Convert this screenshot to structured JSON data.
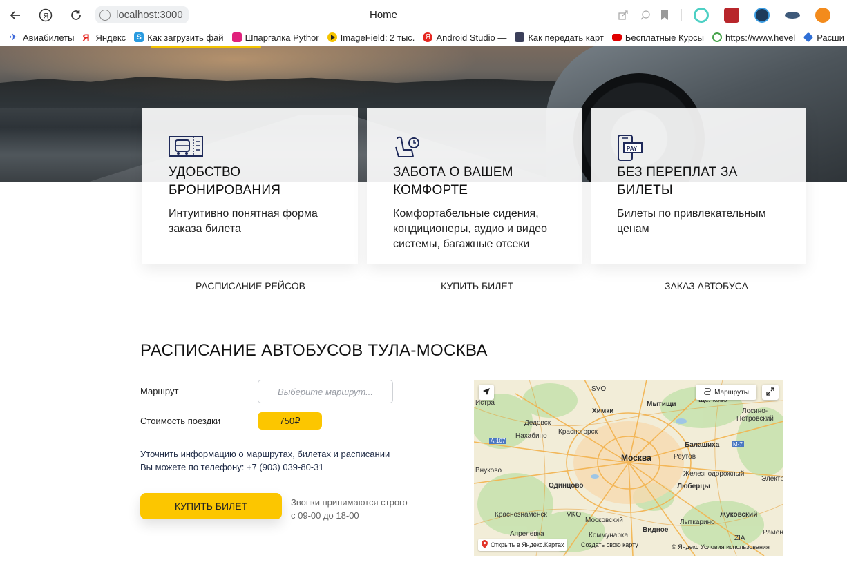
{
  "browser": {
    "address": "localhost:3000",
    "page_title": "Home",
    "bookmarks": [
      {
        "label": "Авиабилеты",
        "icon": "plane-icon",
        "color": "#3a66d9"
      },
      {
        "label": "Яндекс",
        "icon": "yandex-icon",
        "color": "#e52620"
      },
      {
        "label": "Как загрузить фай",
        "icon": "s-icon",
        "color": "#2a9be0"
      },
      {
        "label": "Шпаргалка Pythor",
        "icon": "folder-icon",
        "color": "#e0217c"
      },
      {
        "label": "ImageField: 2 тыс.",
        "icon": "play-icon",
        "color": "#f5c400"
      },
      {
        "label": "Android Studio —",
        "icon": "yandex-icon",
        "color": "#e52620"
      },
      {
        "label": "Как передать карт",
        "icon": "square-icon",
        "color": "#3b3f5a"
      },
      {
        "label": "Бесплатные Курсы",
        "icon": "youtube-icon",
        "color": "#e00000"
      },
      {
        "label": "https://www.hevel",
        "icon": "refresh-icon",
        "color": "#46a34a"
      },
      {
        "label": "Расши",
        "icon": "stack-icon",
        "color": "#2f6fd6"
      }
    ]
  },
  "features": [
    {
      "title": "УДОБСТВО БРОНИРОВАНИЯ",
      "text": "Интуитивно понятная форма заказа билета",
      "icon": "bus-ticket-icon"
    },
    {
      "title": "ЗАБОТА О ВАШЕМ КОМФОРТЕ",
      "text": "Комфортабельные сидения, кондиционеры, аудио и видео системы, багажные отсеки",
      "icon": "seat-clock-icon"
    },
    {
      "title": "БЕЗ ПЕРЕПЛАТ ЗА БИЛЕТЫ",
      "text": "Билеты по привлекательным ценам",
      "icon": "pay-phone-icon"
    }
  ],
  "tabs": [
    "РАСПИСАНИЕ РЕЙСОВ",
    "КУПИТЬ БИЛЕТ",
    "ЗАКАЗ АВТОБУСА"
  ],
  "schedule": {
    "title": "РАСПИСАНИЕ АВТОБУСОВ ТУЛА-МОСКВА",
    "route_label": "Маршрут",
    "route_placeholder": "Выберите маршрут...",
    "price_label": "Стоимость поездки",
    "price_value": "750₽",
    "info_line1": "Уточнить информацию о маршрутах, билетах и расписании",
    "info_line2": "Вы можете по телефону: +7 (903) 039-80-31",
    "buy_button": "КУПИТЬ БИЛЕТ",
    "calls_line1": "Звонки принимаются строго",
    "calls_line2": "с 09-00 до 18-00"
  },
  "map": {
    "routes_button": "Маршруты",
    "open_link": "Открыть в Яндекс.Картах",
    "create_link": "Создать свою карту",
    "copyright": "© Яндекс",
    "terms": "Условия использования",
    "places": {
      "istra": "Истра",
      "svo": "SVO",
      "khimki": "Химки",
      "mytishchi": "Мытищи",
      "shchelkovo": "Щёлково",
      "losino": "Лосино-",
      "petrovsky": "Петровский",
      "dedovsk": "Дедовск",
      "krasnogorsk": "Красногорск",
      "nakhabino": "Нахабино",
      "a107": "A-107",
      "balashikha": "Балашиха",
      "m7": "M-7",
      "moscow": "Москва",
      "reutov": "Реутов",
      "vnukovo_v": "Внуково",
      "zheleznodorozhny": "Железнодорожный",
      "elektro": "Электр",
      "odintsovo": "Одинцово",
      "lyubertsy": "Люберцы",
      "krasnoznamensk": "Краснознаменск",
      "vko": "VKO",
      "moskovsky": "Московский",
      "zhukovsky": "Жуковский",
      "lytkarino": "Лыткарино",
      "vidnoe": "Видное",
      "aprelevka": "Апрелевка",
      "kommunarka": "Коммунарка",
      "ramen": "Рамен",
      "zia": "ZIA"
    }
  },
  "colors": {
    "accent_yellow": "#fcc600",
    "tab_underline": "#8c8f9e",
    "text_dark": "#111111",
    "info_text": "#1e2a45"
  }
}
